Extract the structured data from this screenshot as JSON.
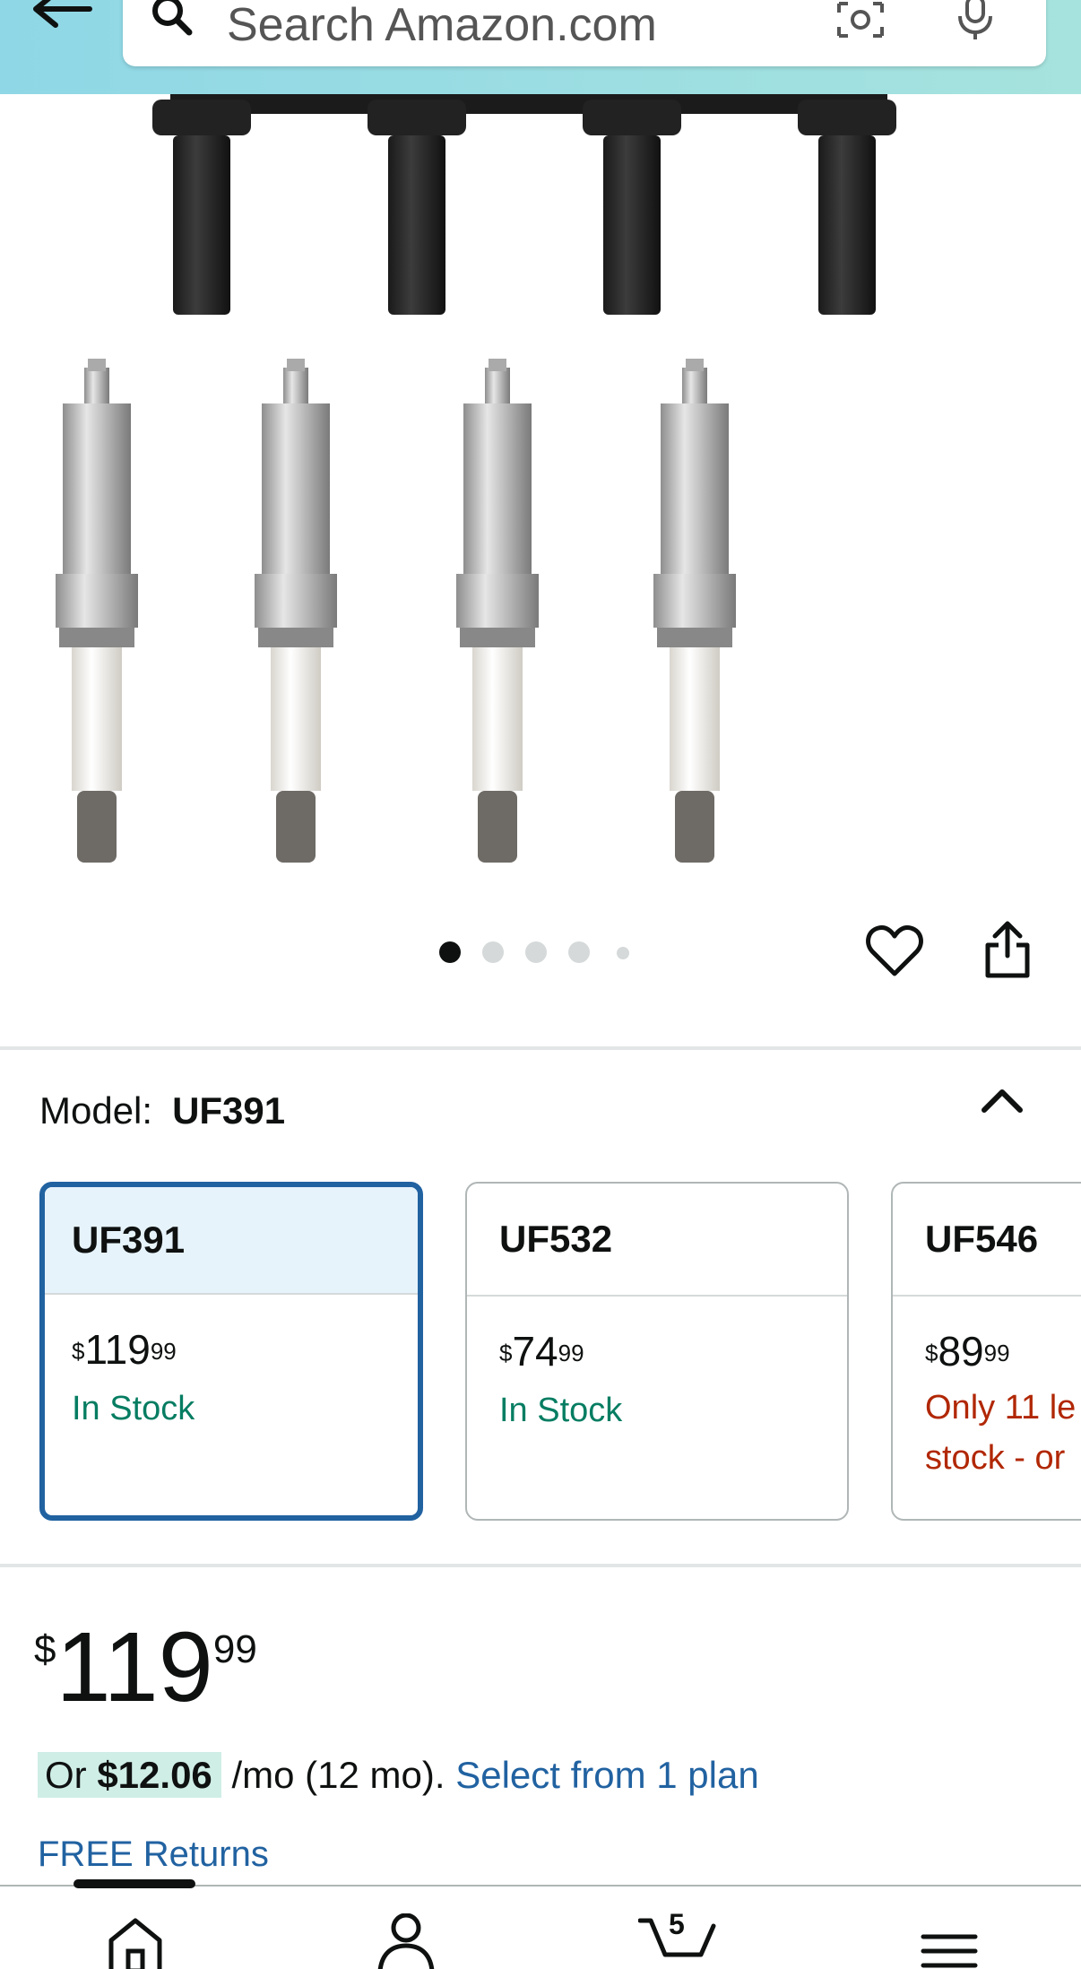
{
  "header": {
    "search_placeholder": "Search Amazon.com"
  },
  "gallery": {
    "dot_count": 5,
    "active_dot": 0
  },
  "model": {
    "label": "Model:",
    "value": "UF391"
  },
  "variants": [
    {
      "name": "UF391",
      "price_symbol": "$",
      "price_whole": "119",
      "price_fraction": "99",
      "stock": "In Stock",
      "selected": true
    },
    {
      "name": "UF532",
      "price_symbol": "$",
      "price_whole": "74",
      "price_fraction": "99",
      "stock": "In Stock",
      "selected": false
    },
    {
      "name": "UF546",
      "price_symbol": "$",
      "price_whole": "89",
      "price_fraction": "99",
      "stock_line1": "Only 11 le",
      "stock_line2": "stock - or",
      "selected": false
    }
  ],
  "price": {
    "symbol": "$",
    "whole": "119",
    "fraction": "99"
  },
  "installment": {
    "prefix": "Or",
    "amount": "$12.06",
    "terms": "/mo (12 mo).",
    "link": "Select from 1 plan"
  },
  "returns": "FREE Returns",
  "bottom_nav": {
    "cart_count": "5"
  },
  "colors": {
    "accent_blue": "#2162a1",
    "in_stock_green": "#067d62",
    "low_stock_red": "#b12704",
    "header_gradient_start": "#8fd7e6",
    "header_gradient_end": "#a6e3de"
  }
}
